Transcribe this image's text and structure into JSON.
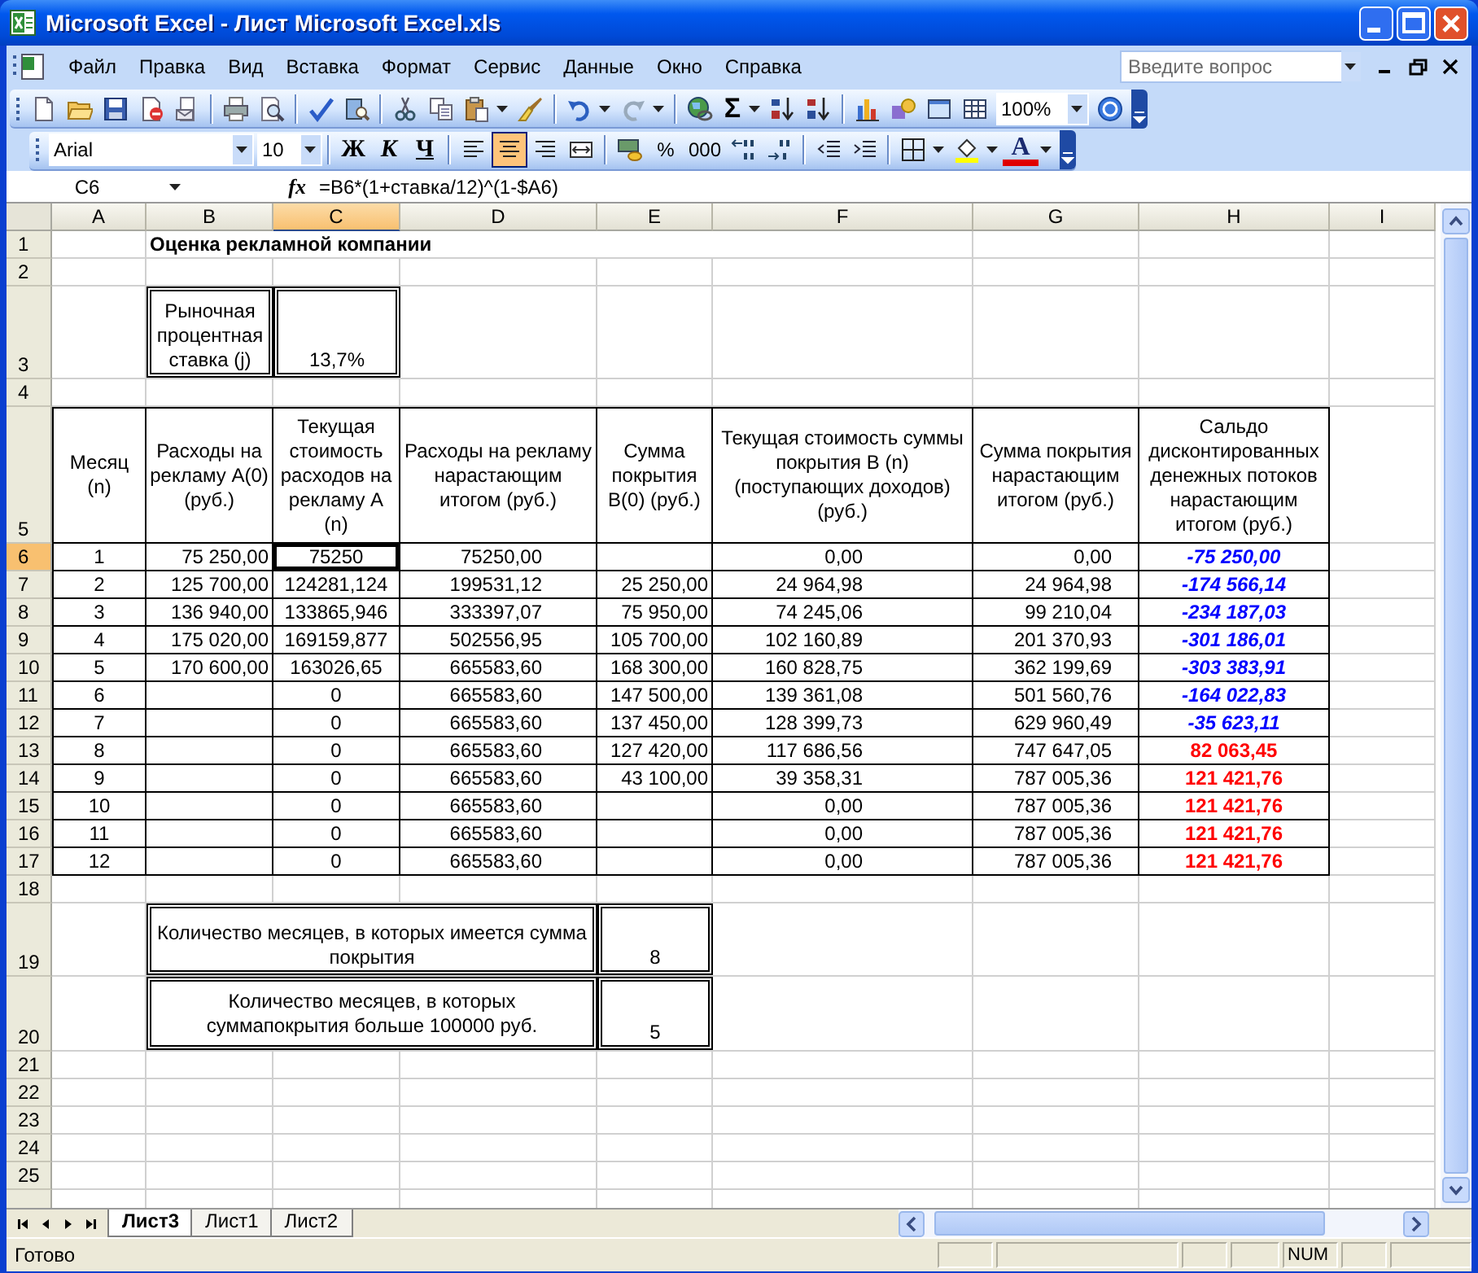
{
  "window": {
    "title": "Microsoft Excel - Лист Microsoft Excel.xls"
  },
  "menu": {
    "items": [
      "Файл",
      "Правка",
      "Вид",
      "Вставка",
      "Формат",
      "Сервис",
      "Данные",
      "Окно",
      "Справка"
    ],
    "help_placeholder": "Введите вопрос"
  },
  "standard_toolbar": {
    "sum_label": "Σ",
    "zoom": "100%"
  },
  "formatting_toolbar": {
    "font": "Arial",
    "size": "10",
    "style_buttons": [
      {
        "kind": "bold",
        "label": "Ж"
      },
      {
        "kind": "italic",
        "label": "К"
      },
      {
        "kind": "underline",
        "label": "Ч"
      }
    ],
    "align_buttons": [
      {
        "kind": "left",
        "selected": false
      },
      {
        "kind": "center",
        "selected": true
      },
      {
        "kind": "right",
        "selected": false
      }
    ],
    "percent_label": "%",
    "thousands_label": "000",
    "font_color_label": "A"
  },
  "formula_bar": {
    "name_box": "C6",
    "function_label": "fx",
    "formula": "=B6*(1+ставка/12)^(1-$A6)"
  },
  "sheet": {
    "columns": [
      {
        "label": "A",
        "selected": false
      },
      {
        "label": "B",
        "selected": false
      },
      {
        "label": "C",
        "selected": true
      },
      {
        "label": "D",
        "selected": false
      },
      {
        "label": "E",
        "selected": false
      },
      {
        "label": "F",
        "selected": false
      },
      {
        "label": "G",
        "selected": false
      },
      {
        "label": "H",
        "selected": false
      },
      {
        "label": "I",
        "selected": false
      }
    ],
    "rows": [
      {
        "number": "1",
        "selected": false,
        "kind": "title",
        "cells": {
          "b": "Оценка рекламной компании"
        }
      },
      {
        "number": "2",
        "selected": false,
        "kind": "blank"
      },
      {
        "number": "3",
        "selected": false,
        "kind": "rate",
        "cells": {
          "b": "Рыночная процентная ставка (j)",
          "c": "13,7%"
        }
      },
      {
        "number": "4",
        "selected": false,
        "kind": "blank"
      },
      {
        "number": "5",
        "selected": false,
        "kind": "header",
        "cells": {
          "a": "Месяц (n)",
          "b": "Расходы на рекламу A(0) (руб.)",
          "c": "Текущая стоимость расходов на рекламу А (n)",
          "d": "Расходы на рекламу нарастающим итогом (руб.)",
          "e": "Сумма покрытия B(0) (руб.)",
          "f": "Текущая стоимость суммы покрытия  B (n) (поступающих доходов) (руб.)",
          "g": "Сумма покрытия нарастающим итогом (руб.)",
          "h": "Сальдо дисконтированных денежных потоков нарастающим итогом (руб.)"
        }
      },
      {
        "number": "6",
        "selected": true,
        "kind": "data",
        "cells": {
          "a": "1",
          "b": "75 250,00",
          "c": "75250",
          "d": "75250,00",
          "f": "0,00",
          "g": "0,00"
        },
        "balance": {
          "text": "-75 250,00",
          "color": "#0000ff",
          "italic": true
        }
      },
      {
        "number": "7",
        "selected": false,
        "kind": "data",
        "cells": {
          "a": "2",
          "b": "125 700,00",
          "c": "124281,124",
          "d": "199531,12",
          "e": "25 250,00",
          "f": "24 964,98",
          "g": "24 964,98"
        },
        "balance": {
          "text": "-174 566,14",
          "color": "#0000ff",
          "italic": true
        }
      },
      {
        "number": "8",
        "selected": false,
        "kind": "data",
        "cells": {
          "a": "3",
          "b": "136 940,00",
          "c": "133865,946",
          "d": "333397,07",
          "e": "75 950,00",
          "f": "74 245,06",
          "g": "99 210,04"
        },
        "balance": {
          "text": "-234 187,03",
          "color": "#0000ff",
          "italic": true
        }
      },
      {
        "number": "9",
        "selected": false,
        "kind": "data",
        "cells": {
          "a": "4",
          "b": "175 020,00",
          "c": "169159,877",
          "d": "502556,95",
          "e": "105 700,00",
          "f": "102 160,89",
          "g": "201 370,93"
        },
        "balance": {
          "text": "-301 186,01",
          "color": "#0000ff",
          "italic": true
        }
      },
      {
        "number": "10",
        "selected": false,
        "kind": "data",
        "cells": {
          "a": "5",
          "b": "170 600,00",
          "c": "163026,65",
          "d": "665583,60",
          "e": "168 300,00",
          "f": "160 828,75",
          "g": "362 199,69"
        },
        "balance": {
          "text": "-303 383,91",
          "color": "#0000ff",
          "italic": true
        }
      },
      {
        "number": "11",
        "selected": false,
        "kind": "data",
        "cells": {
          "a": "6",
          "c": "0",
          "d": "665583,60",
          "e": "147 500,00",
          "f": "139 361,08",
          "g": "501 560,76"
        },
        "balance": {
          "text": "-164 022,83",
          "color": "#0000ff",
          "italic": true
        }
      },
      {
        "number": "12",
        "selected": false,
        "kind": "data",
        "cells": {
          "a": "7",
          "c": "0",
          "d": "665583,60",
          "e": "137 450,00",
          "f": "128 399,73",
          "g": "629 960,49"
        },
        "balance": {
          "text": "-35 623,11",
          "color": "#0000ff",
          "italic": true
        }
      },
      {
        "number": "13",
        "selected": false,
        "kind": "data",
        "cells": {
          "a": "8",
          "c": "0",
          "d": "665583,60",
          "e": "127 420,00",
          "f": "117 686,56",
          "g": "747 647,05"
        },
        "balance": {
          "text": "82 063,45",
          "color": "#ff0000",
          "italic": false
        }
      },
      {
        "number": "14",
        "selected": false,
        "kind": "data",
        "cells": {
          "a": "9",
          "c": "0",
          "d": "665583,60",
          "e": "43 100,00",
          "f": "39 358,31",
          "g": "787 005,36"
        },
        "balance": {
          "text": "121 421,76",
          "color": "#ff0000",
          "italic": false
        }
      },
      {
        "number": "15",
        "selected": false,
        "kind": "data",
        "cells": {
          "a": "10",
          "c": "0",
          "d": "665583,60",
          "f": "0,00",
          "g": "787 005,36"
        },
        "balance": {
          "text": "121 421,76",
          "color": "#ff0000",
          "italic": false
        }
      },
      {
        "number": "16",
        "selected": false,
        "kind": "data",
        "cells": {
          "a": "11",
          "c": "0",
          "d": "665583,60",
          "f": "0,00",
          "g": "787 005,36"
        },
        "balance": {
          "text": "121 421,76",
          "color": "#ff0000",
          "italic": false
        }
      },
      {
        "number": "17",
        "selected": false,
        "kind": "data",
        "cells": {
          "a": "12",
          "c": "0",
          "d": "665583,60",
          "f": "0,00",
          "g": "787 005,36"
        },
        "balance": {
          "text": "121 421,76",
          "color": "#ff0000",
          "italic": false
        }
      },
      {
        "number": "18",
        "selected": false,
        "kind": "blank"
      },
      {
        "number": "19",
        "selected": false,
        "kind": "summary",
        "cells": {
          "b": "Количество месяцев, в которых имеется сумма покрытия",
          "e": "8"
        }
      },
      {
        "number": "20",
        "selected": false,
        "kind": "summary2",
        "cells": {
          "b": "Количество месяцев, в которых суммапокрытия больше 100000 руб.",
          "e": "5"
        }
      },
      {
        "number": "21",
        "selected": false,
        "kind": "blank"
      },
      {
        "number": "22",
        "selected": false,
        "kind": "blank"
      },
      {
        "number": "23",
        "selected": false,
        "kind": "blank"
      },
      {
        "number": "24",
        "selected": false,
        "kind": "blank"
      },
      {
        "number": "25",
        "selected": false,
        "kind": "blank"
      }
    ]
  },
  "sheet_tabs": [
    {
      "label": "Лист3",
      "selected": true
    },
    {
      "label": "Лист1",
      "selected": false
    },
    {
      "label": "Лист2",
      "selected": false
    }
  ],
  "status_bar": {
    "text": "Готово",
    "indicator": "NUM"
  }
}
